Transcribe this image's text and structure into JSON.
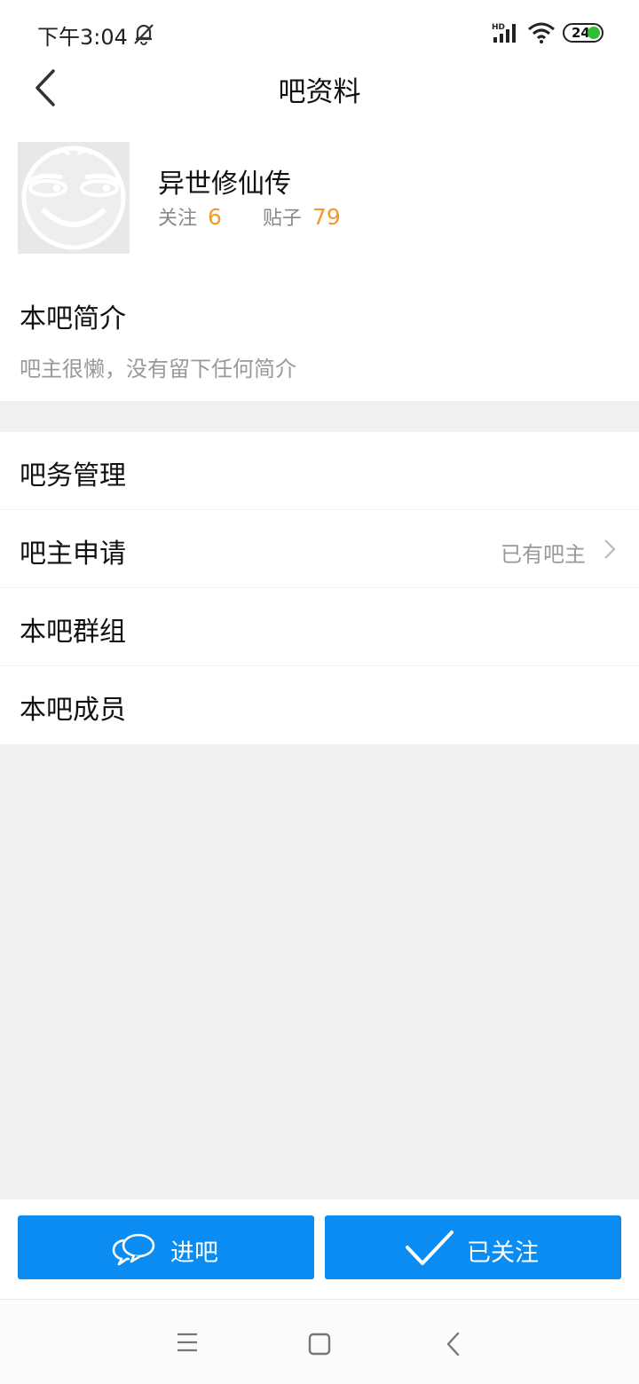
{
  "status_bar": {
    "time": "下午3:04",
    "battery_level": "24",
    "icons": [
      "bell-off-icon",
      "signal-hd-icon",
      "wifi-icon",
      "battery-icon"
    ]
  },
  "header": {
    "title": "吧资料",
    "back_icon": "back-arrow-icon"
  },
  "forum": {
    "name": "异世修仙传",
    "follow_label": "关注",
    "follow_count": "6",
    "posts_label": "贴子",
    "posts_count": "79",
    "avatar_icon": "smiley-placeholder-icon"
  },
  "intro": {
    "title": "本吧简介",
    "text": "吧主很懒，没有留下任何简介"
  },
  "menu": {
    "items": [
      {
        "label": "吧务管理",
        "value": ""
      },
      {
        "label": "吧主申请",
        "value": "已有吧主"
      },
      {
        "label": "本吧群组",
        "value": ""
      },
      {
        "label": "本吧成员",
        "value": ""
      }
    ]
  },
  "actions": {
    "enter_label": "进吧",
    "followed_label": "已关注"
  },
  "colors": {
    "accent": "#0a8cf2",
    "count_orange": "#f39a2b",
    "background": "#f0f0f0",
    "battery_green": "#2fbf32"
  }
}
